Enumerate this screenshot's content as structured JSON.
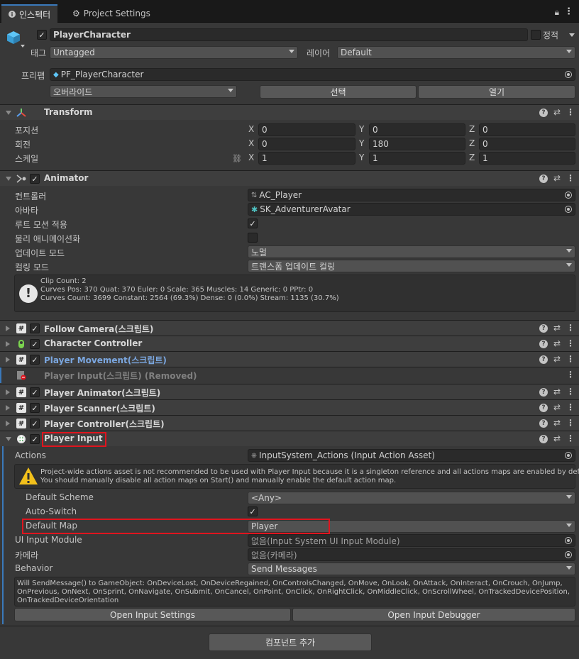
{
  "tabs": {
    "inspector": "인스펙터",
    "settings": "Project Settings"
  },
  "gameobject": {
    "name": "PlayerCharacter",
    "static_label": "정적",
    "tag_label": "태그",
    "tag_value": "Untagged",
    "layer_label": "레이어",
    "layer_value": "Default"
  },
  "prefab": {
    "label": "프리팹",
    "asset": "PF_PlayerCharacter",
    "overrides": "오버라이드",
    "select": "선택",
    "open": "열기"
  },
  "transform": {
    "title": "Transform",
    "position_label": "포지션",
    "rotation_label": "회전",
    "scale_label": "스케일",
    "x": "X",
    "y": "Y",
    "z": "Z",
    "position": [
      "0",
      "0",
      "0"
    ],
    "rotation": [
      "0",
      "180",
      "0"
    ],
    "scale": [
      "1",
      "1",
      "1"
    ]
  },
  "animator": {
    "title": "Animator",
    "controller_label": "컨트롤러",
    "controller_value": "AC_Player",
    "avatar_label": "아바타",
    "avatar_value": "SK_AdventurerAvatar",
    "root_motion_label": "루트 모션 적용",
    "physics_label": "물리 애니메이션화",
    "update_label": "업데이트 모드",
    "update_value": "노멀",
    "culling_label": "컬링 모드",
    "culling_value": "트랜스폼 업데이트 컬링",
    "info": [
      "Clip Count: 2",
      "Curves Pos: 370 Quat: 370 Euler: 0 Scale: 365 Muscles: 14 Generic: 0 PPtr: 0",
      "Curves Count: 3699 Constant: 2564 (69.3%) Dense: 0 (0.0%) Stream: 1135 (30.7%)"
    ]
  },
  "components": [
    {
      "name": "Follow Camera(스크립트)"
    },
    {
      "name": "Character Controller"
    },
    {
      "name": "Player Movement(스크립트)"
    },
    {
      "name": "Player Input(스크립트) (Removed)"
    },
    {
      "name": "Player Animator(스크립트)"
    },
    {
      "name": "Player Scanner(스크립트)"
    },
    {
      "name": "Player Controller(스크립트)"
    }
  ],
  "player_input": {
    "title": "Player Input",
    "actions_label": "Actions",
    "actions_value": "InputSystem_Actions (Input Action Asset)",
    "warning": [
      "Project-wide actions asset is not recommended to be used with Player Input because it is a singleton reference and all actions maps are enabled by default.",
      "You should manually disable all action maps on Start() and manually enable the default action map."
    ],
    "scheme_label": "Default Scheme",
    "scheme_value": "<Any>",
    "autoswitch_label": "Auto-Switch",
    "map_label": "Default Map",
    "map_value": "Player",
    "ui_module_label": "UI Input Module",
    "ui_module_value": "없음(Input System UI Input Module)",
    "camera_label": "카메라",
    "camera_value": "없음(카메라)",
    "behavior_label": "Behavior",
    "behavior_value": "Send Messages",
    "messages": [
      "Will SendMessage() to GameObject: OnDeviceLost, OnDeviceRegained, OnControlsChanged, OnMove, OnLook, OnAttack, OnInteract, OnCrouch, OnJump,",
      "OnPrevious, OnNext, OnSprint, OnNavigate, OnSubmit, OnCancel, OnPoint, OnClick, OnRightClick, OnMiddleClick, OnScrollWheel, OnTrackedDevicePosition,",
      "OnTrackedDeviceOrientation"
    ],
    "open_settings": "Open Input Settings",
    "open_debugger": "Open Input Debugger"
  },
  "add_component": "컴포넌트 추가",
  "colors": {
    "accent": "#3a79bb",
    "highlight": "#e0141e",
    "link": "#7ba7e0"
  }
}
